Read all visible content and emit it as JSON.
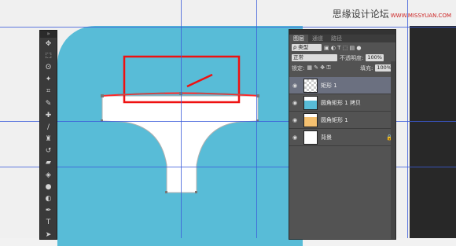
{
  "watermark": {
    "text": "思缘设计论坛",
    "url": "WWW.MISSYUAN.COM"
  },
  "toolbar": {
    "grip": "»",
    "tools": [
      {
        "icon": "move-icon",
        "glyph": "✥"
      },
      {
        "icon": "marquee-icon",
        "glyph": "⬚"
      },
      {
        "icon": "lasso-icon",
        "glyph": "ʘ"
      },
      {
        "icon": "magic-wand-icon",
        "glyph": "✦"
      },
      {
        "icon": "crop-icon",
        "glyph": "⌗"
      },
      {
        "icon": "eyedropper-icon",
        "glyph": "✎"
      },
      {
        "icon": "healing-brush-icon",
        "glyph": "✚"
      },
      {
        "icon": "brush-icon",
        "glyph": "∕"
      },
      {
        "icon": "stamp-icon",
        "glyph": "♜"
      },
      {
        "icon": "history-brush-icon",
        "glyph": "↺"
      },
      {
        "icon": "eraser-icon",
        "glyph": "▰"
      },
      {
        "icon": "paint-bucket-icon",
        "glyph": "◈"
      },
      {
        "icon": "blur-icon",
        "glyph": "●"
      },
      {
        "icon": "dodge-icon",
        "glyph": "◐"
      },
      {
        "icon": "pen-icon",
        "glyph": "✒"
      },
      {
        "icon": "type-icon",
        "glyph": "T"
      },
      {
        "icon": "path-selection-icon",
        "glyph": "➤"
      }
    ]
  },
  "panel": {
    "tabs": [
      "图层",
      "通道",
      "路径"
    ],
    "filter_label": "ρ 类型",
    "blend_mode": "正常",
    "opacity_label": "不透明度:",
    "opacity_value": "100%",
    "lock_label": "锁定:",
    "fill_label": "填充:",
    "fill_value": "100%",
    "layers": [
      {
        "name": "矩形 1",
        "selected": true,
        "thumb": "checker",
        "locked": false
      },
      {
        "name": "圆角矩形 1 拷贝",
        "selected": false,
        "thumb": "blue",
        "locked": false
      },
      {
        "name": "圆角矩形 1",
        "selected": false,
        "thumb": "orange",
        "locked": false
      },
      {
        "name": "背景",
        "selected": false,
        "thumb": "white",
        "locked": true
      }
    ]
  },
  "colors": {
    "shape": "#58bcd7",
    "path": "#ff2a2a",
    "guide": "#3b5bd9",
    "panel_bg": "#535353"
  }
}
